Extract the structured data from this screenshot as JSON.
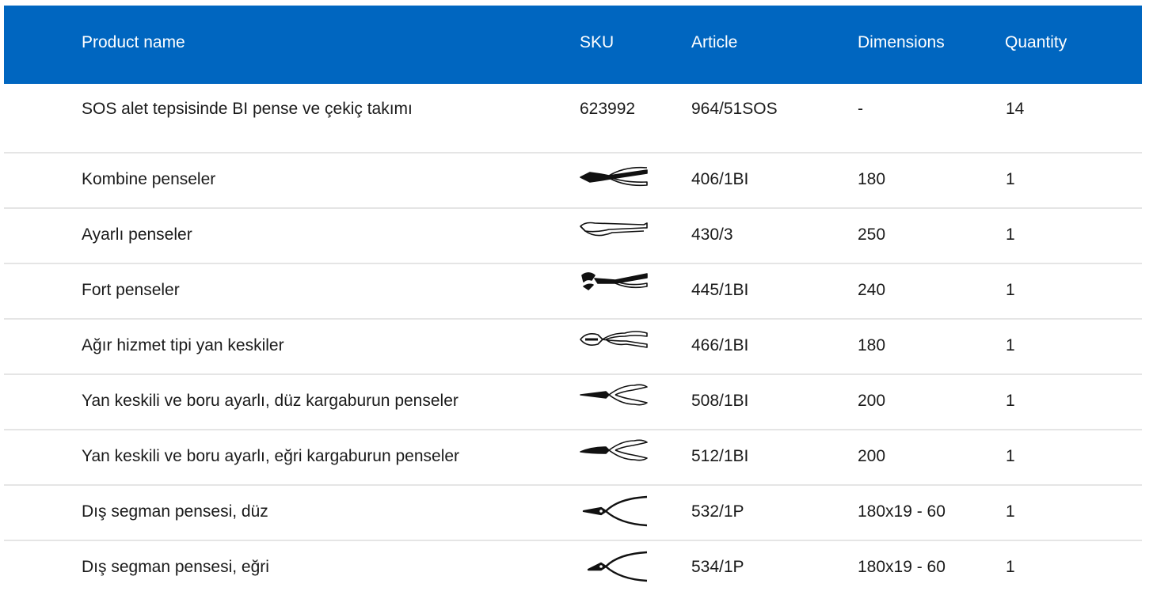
{
  "table": {
    "headers": {
      "product_name": "Product name",
      "sku": "SKU",
      "article": "Article",
      "dimensions": "Dimensions",
      "quantity": "Quantity"
    },
    "rows": [
      {
        "name": "SOS alet tepsisinde BI pense ve çekiç takımı",
        "sku": "623992",
        "article": "964/51SOS",
        "dimensions": "-",
        "quantity": "14"
      },
      {
        "name": "Kombine penseler",
        "sku_icon": "combination-pliers-icon",
        "article": "406/1BI",
        "dimensions": "180",
        "quantity": "1"
      },
      {
        "name": "Ayarlı penseler",
        "sku_icon": "locking-pliers-icon",
        "article": "430/3",
        "dimensions": "250",
        "quantity": "1"
      },
      {
        "name": "Fort penseler",
        "sku_icon": "water-pump-pliers-icon",
        "article": "445/1BI",
        "dimensions": "240",
        "quantity": "1"
      },
      {
        "name": "Ağır hizmet tipi yan keskiler",
        "sku_icon": "side-cutter-icon",
        "article": "466/1BI",
        "dimensions": "180",
        "quantity": "1"
      },
      {
        "name": "Yan keskili ve boru ayarlı, düz kargaburun penseler",
        "sku_icon": "needle-nose-pliers-icon",
        "article": "508/1BI",
        "dimensions": "200",
        "quantity": "1"
      },
      {
        "name": "Yan keskili ve boru ayarlı, eğri kargaburun penseler",
        "sku_icon": "bent-nose-pliers-icon",
        "article": "512/1BI",
        "dimensions": "200",
        "quantity": "1"
      },
      {
        "name": "Dış segman pensesi, düz",
        "sku_icon": "circlip-pliers-icon",
        "article": "532/1P",
        "dimensions": "180x19 - 60",
        "quantity": "1"
      },
      {
        "name": "Dış segman pensesi, eğri",
        "sku_icon": "circlip-pliers-bent-icon",
        "article": "534/1P",
        "dimensions": "180x19 - 60",
        "quantity": "1"
      }
    ]
  },
  "colors": {
    "header_bg": "#0066c0",
    "header_text": "#ffffff",
    "row_divider": "#e5e5e5"
  }
}
